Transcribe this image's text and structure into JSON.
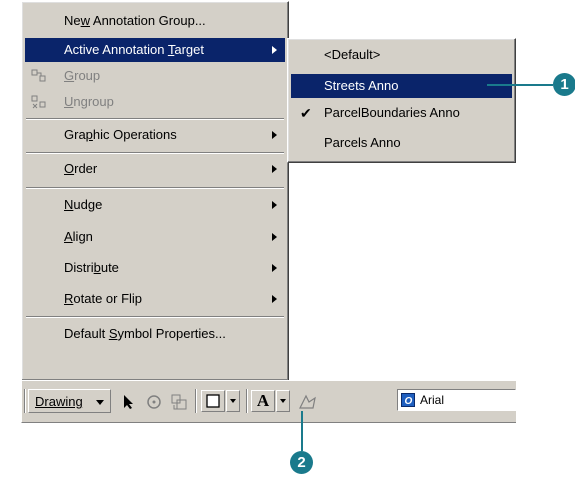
{
  "main_menu": {
    "items": [
      {
        "label": "New Annotation Group...",
        "type": "item"
      },
      {
        "label": "Active Annotation Target",
        "type": "submenu",
        "highlighted": true
      },
      {
        "label": "Group",
        "type": "item",
        "disabled": true,
        "icon": "group-icon"
      },
      {
        "label": "Ungroup",
        "type": "item",
        "disabled": true,
        "icon": "ungroup-icon"
      },
      {
        "label": "Graphic Operations",
        "type": "submenu"
      },
      {
        "label": "Order",
        "type": "submenu"
      },
      {
        "label": "Nudge",
        "type": "submenu"
      },
      {
        "label": "Align",
        "type": "submenu"
      },
      {
        "label": "Distribute",
        "type": "submenu"
      },
      {
        "label": "Rotate or Flip",
        "type": "submenu"
      },
      {
        "label": "Default Symbol Properties...",
        "type": "item"
      }
    ]
  },
  "submenu": {
    "items": [
      {
        "label": "<Default>",
        "checked": false
      },
      {
        "label": "Streets Anno",
        "highlighted": true,
        "checked": false
      },
      {
        "label": "ParcelBoundaries Anno",
        "checked": true
      },
      {
        "label": "Parcels Anno",
        "checked": false
      }
    ]
  },
  "toolbar": {
    "drawing_label": "Drawing",
    "font_label": "A",
    "font_name": "Arial",
    "icons": [
      "select-elements-icon",
      "rotate-icon",
      "zoom-to-elements-icon",
      "rectangle-icon",
      "font-color-icon",
      "edit-annotation-icon"
    ]
  },
  "callouts": [
    "1",
    "2"
  ],
  "colors": {
    "highlight": "#0a246a",
    "menu_bg": "#d4d0c8",
    "callout": "#1a7a8c",
    "disabled_text": "#808080"
  }
}
